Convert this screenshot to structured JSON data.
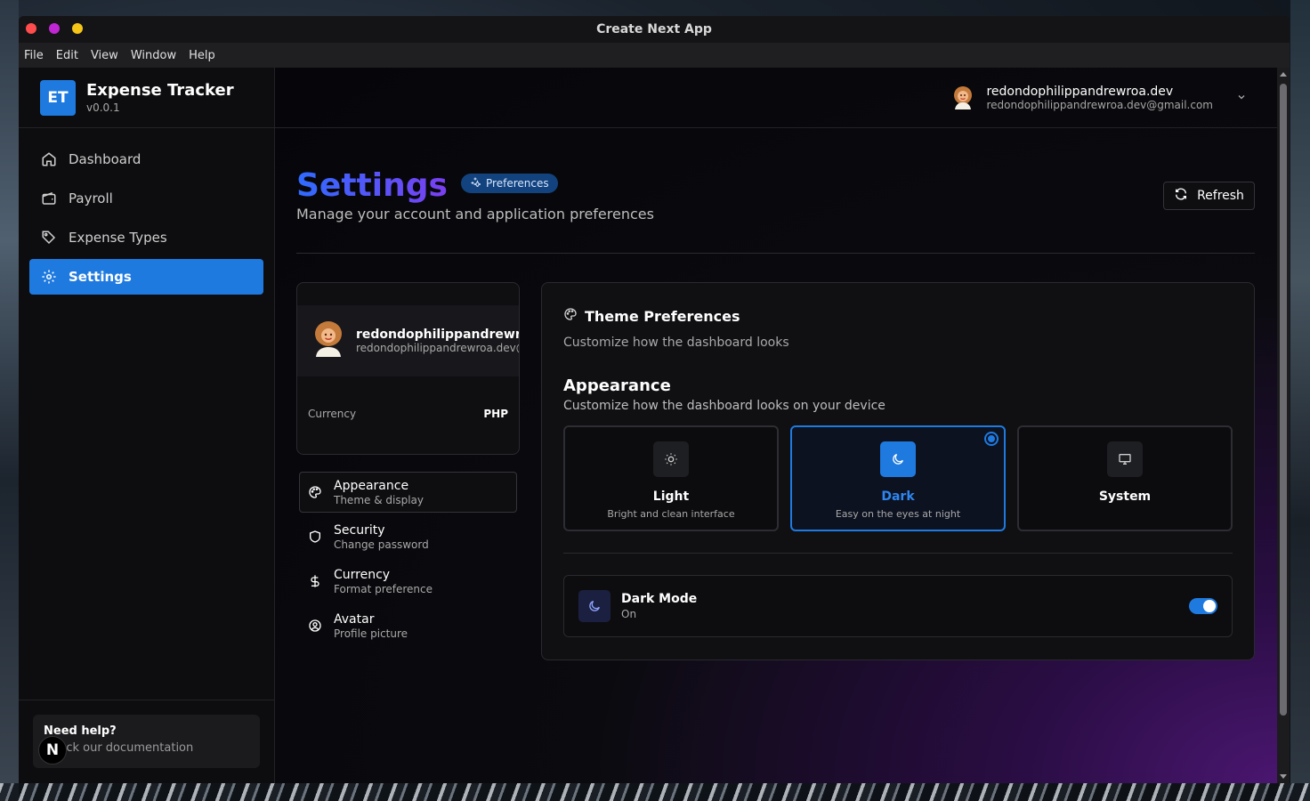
{
  "window": {
    "title": "Create Next App"
  },
  "menu": [
    "File",
    "Edit",
    "View",
    "Window",
    "Help"
  ],
  "brand": {
    "initials": "ET",
    "name": "Expense Tracker",
    "version": "v0.0.1"
  },
  "nav": [
    {
      "label": "Dashboard",
      "icon": "home-icon"
    },
    {
      "label": "Payroll",
      "icon": "wallet-icon"
    },
    {
      "label": "Expense Types",
      "icon": "tag-icon"
    },
    {
      "label": "Settings",
      "icon": "gear-icon",
      "active": true
    }
  ],
  "help": {
    "title": "Need help?",
    "subtitle": "Check our documentation",
    "badge": "N"
  },
  "user": {
    "name": "redondophilippandrewroa.dev",
    "email": "redondophilippandrewroa.dev@gmail.com"
  },
  "page": {
    "title": "Settings",
    "badge": "Preferences",
    "subtitle": "Manage your account and application preferences",
    "refresh_label": "Refresh"
  },
  "profile": {
    "name": "redondophilippandrewroa.dev",
    "email": "redondophilippandrewroa.dev@gmail.com",
    "currency_label": "Currency",
    "currency_value": "PHP"
  },
  "subnav": [
    {
      "label": "Appearance",
      "desc": "Theme & display",
      "icon": "palette-icon",
      "active": true
    },
    {
      "label": "Security",
      "desc": "Change password",
      "icon": "shield-icon"
    },
    {
      "label": "Currency",
      "desc": "Format preference",
      "icon": "dollar-icon"
    },
    {
      "label": "Avatar",
      "desc": "Profile picture",
      "icon": "user-circle-icon"
    }
  ],
  "theme": {
    "title": "Theme Preferences",
    "subtitle": "Customize how the dashboard looks",
    "appearance_title": "Appearance",
    "appearance_subtitle": "Customize how the dashboard looks on your device",
    "options": [
      {
        "label": "Light",
        "desc": "Bright and clean interface",
        "icon": "sun-icon"
      },
      {
        "label": "Dark",
        "desc": "Easy on the eyes at night",
        "icon": "moon-icon",
        "selected": true
      },
      {
        "label": "System",
        "desc": "",
        "icon": "monitor-icon"
      }
    ],
    "dark_mode_label": "Dark Mode",
    "dark_mode_state": "On",
    "dark_mode_enabled": true
  },
  "colors": {
    "accent": "#1f7ae0",
    "title_gradient_start": "#2f6bff",
    "title_gradient_end": "#7b3ff2"
  }
}
